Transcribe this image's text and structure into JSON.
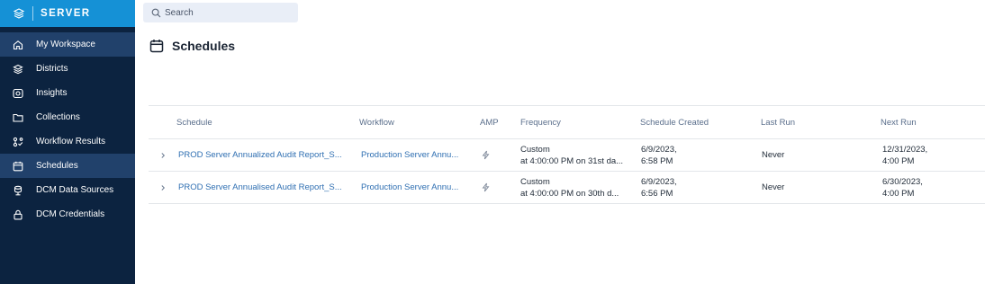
{
  "app": {
    "brand": "SERVER",
    "brand_color": "#1591d6",
    "sidebar_color": "#0c2340"
  },
  "sidebar": {
    "items": [
      {
        "label": "My Workspace",
        "icon": "home-icon"
      },
      {
        "label": "Districts",
        "icon": "layers-icon"
      },
      {
        "label": "Insights",
        "icon": "insights-icon"
      },
      {
        "label": "Collections",
        "icon": "folder-icon"
      },
      {
        "label": "Workflow Results",
        "icon": "workflow-results-icon"
      },
      {
        "label": "Schedules",
        "icon": "calendar-icon",
        "active": true
      },
      {
        "label": "DCM Data Sources",
        "icon": "data-source-icon"
      },
      {
        "label": "DCM Credentials",
        "icon": "lock-icon"
      }
    ]
  },
  "search": {
    "placeholder": "Search",
    "value": ""
  },
  "page": {
    "title": "Schedules"
  },
  "table": {
    "columns": [
      "Schedule",
      "Workflow",
      "AMP",
      "Frequency",
      "Schedule Created",
      "Last Run",
      "Next Run"
    ],
    "rows": [
      {
        "schedule": "PROD Server Annualized Audit Report_S...",
        "workflow": "Production Server Annu...",
        "frequency_line1": "Custom",
        "frequency_line2": "at 4:00:00 PM on 31st da...",
        "created_line1": "6/9/2023,",
        "created_line2": "6:58 PM",
        "last_run": "Never",
        "next_run_line1": "12/31/2023,",
        "next_run_line2": "4:00 PM"
      },
      {
        "schedule": "PROD Server Annualised Audit Report_S...",
        "workflow": "Production Server Annu...",
        "frequency_line1": "Custom",
        "frequency_line2": "at 4:00:00 PM on 30th d...",
        "created_line1": "6/9/2023,",
        "created_line2": "6:56 PM",
        "last_run": "Never",
        "next_run_line1": "6/30/2023,",
        "next_run_line2": "4:00 PM"
      }
    ]
  }
}
